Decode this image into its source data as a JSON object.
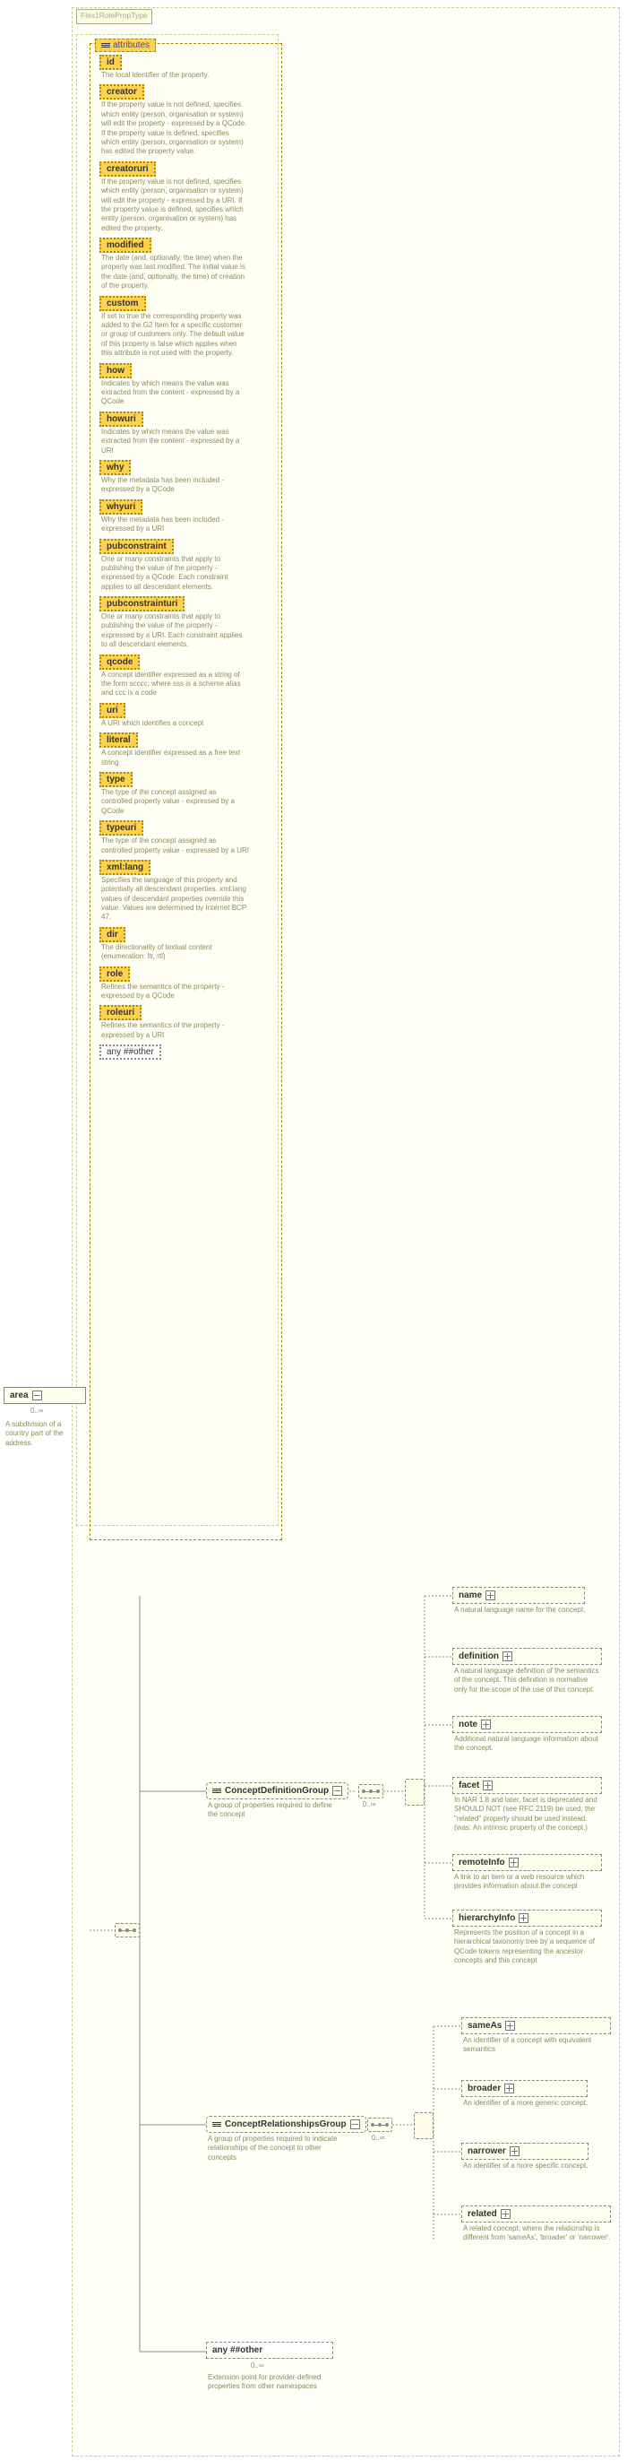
{
  "root_type": "Flex1RolePropType",
  "area": {
    "label": "area",
    "card": "0..∞",
    "desc": "A subdivision of a country part of the address."
  },
  "attributes_label": "attributes",
  "attributes": [
    {
      "name": "id",
      "desc": "The local identifier of the property."
    },
    {
      "name": "creator",
      "desc": "If the property value is not defined, specifies which entity (person, organisation or system) will edit the property - expressed by a QCode. If the property value is defined, specifies which entity (person, organisation or system) has edited the property value."
    },
    {
      "name": "creatoruri",
      "desc": "If the property value is not defined, specifies which entity (person, organisation or system) will edit the property - expressed by a URI. If the property value is defined, specifies which entity (person, organisation or system) has edited the property."
    },
    {
      "name": "modified",
      "desc": "The date (and, optionally, the time) when the property was last modified. The initial value is the date (and, optionally, the time) of creation of the property."
    },
    {
      "name": "custom",
      "desc": "If set to true the corresponding property was added to the G2 Item for a specific customer or group of customers only. The default value of this property is false which applies when this attribute is not used with the property."
    },
    {
      "name": "how",
      "desc": "Indicates by which means the value was extracted from the content - expressed by a QCode"
    },
    {
      "name": "howuri",
      "desc": "Indicates by which means the value was extracted from the content - expressed by a URI"
    },
    {
      "name": "why",
      "desc": "Why the metadata has been included - expressed by a QCode"
    },
    {
      "name": "whyuri",
      "desc": "Why the metadata has been included - expressed by a URI"
    },
    {
      "name": "pubconstraint",
      "desc": "One or many constraints that apply to publishing the value of the property - expressed by a QCode. Each constraint applies to all descendant elements."
    },
    {
      "name": "pubconstrainturi",
      "desc": "One or many constraints that apply to publishing the value of the property - expressed by a URI. Each constraint applies to all descendant elements."
    },
    {
      "name": "qcode",
      "desc": "A concept identifier expressed as a string of the form scccc, where sss is a scheme alias and ccc is a code"
    },
    {
      "name": "uri",
      "desc": "A URI which identifies a concept"
    },
    {
      "name": "literal",
      "desc": "A concept identifier expressed as a free text string"
    },
    {
      "name": "type",
      "desc": "The type of the concept assigned as controlled property value - expressed by a QCode"
    },
    {
      "name": "typeuri",
      "desc": "The type of the concept assigned as controlled property value - expressed by a URI"
    },
    {
      "name": "xml:lang",
      "desc": "Specifies the language of this property and potentially all descendant properties. xml:lang values of descendant properties override this value. Values are determined by Internet BCP 47."
    },
    {
      "name": "dir",
      "desc": "The directionality of textual content (enumeration: ltr, rtl)"
    },
    {
      "name": "role",
      "desc": "Refines the semantics of the property - expressed by a QCode"
    },
    {
      "name": "roleuri",
      "desc": "Refines the semantics of the property - expressed by a URI"
    }
  ],
  "any_other_1": "any ##other",
  "groups": {
    "cdg": {
      "label": "ConceptDefinitionGroup",
      "card": "0..∞",
      "desc": "A group of properties required to define the concept",
      "children": [
        {
          "name": "name",
          "desc": "A natural language name for the concept."
        },
        {
          "name": "definition",
          "desc": "A natural language definition of the semantics of the concept. This definition is normative only for the scope of the use of this concept."
        },
        {
          "name": "note",
          "desc": "Additional natural language information about the concept."
        },
        {
          "name": "facet",
          "desc": "In NAR 1.8 and later, facet is deprecated and SHOULD NOT (see RFC 2119) be used, the \"related\" property should be used instead. (was: An intrinsic property of the concept.)"
        },
        {
          "name": "remoteInfo",
          "desc": "A link to an item or a web resource which provides information about the concept"
        },
        {
          "name": "hierarchyInfo",
          "desc": "Represents the position of a concept in a hierarchical taxonomy tree by a sequence of QCode tokens representing the ancestor concepts and this concept"
        }
      ]
    },
    "crg": {
      "label": "ConceptRelationshipsGroup",
      "card": "0..∞",
      "desc": "A group of properties required to indicate relationships of the concept to other concepts",
      "children": [
        {
          "name": "sameAs",
          "desc": "An identifier of a concept with equivalent semantics"
        },
        {
          "name": "broader",
          "desc": "An identifier of a more generic concept."
        },
        {
          "name": "narrower",
          "desc": "An identifier of a more specific concept."
        },
        {
          "name": "related",
          "desc": "A related concept, where the relationship is different from 'sameAs', 'broader' or 'narrower'."
        }
      ]
    }
  },
  "any_ext": {
    "label": "any ##other",
    "card": "0..∞",
    "desc": "Extension point for provider-defined properties from other namespaces"
  }
}
